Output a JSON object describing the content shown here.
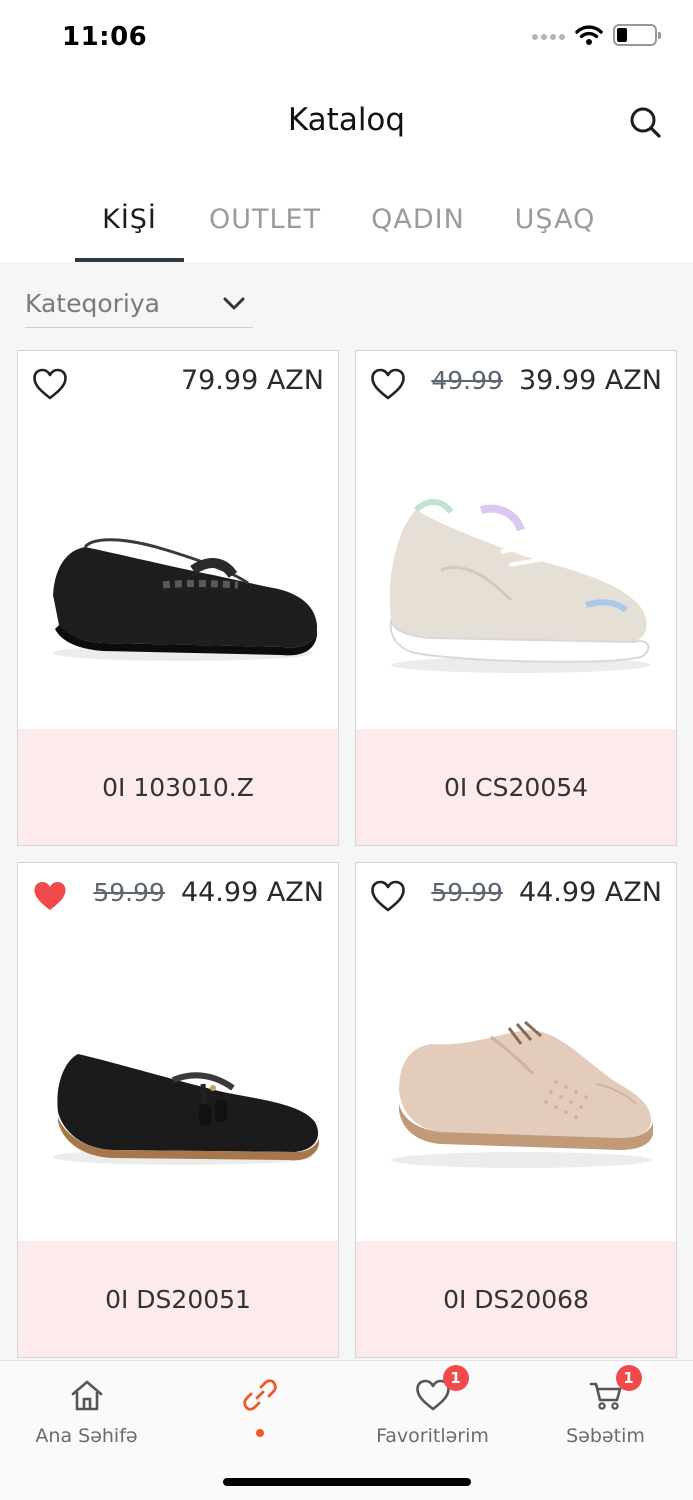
{
  "status_bar": {
    "time": "11:06"
  },
  "header": {
    "title": "Kataloq"
  },
  "tabs": [
    {
      "label": "KİŞİ",
      "active": true
    },
    {
      "label": "OUTLET",
      "active": false
    },
    {
      "label": "QADIN",
      "active": false
    },
    {
      "label": "UŞAQ",
      "active": false
    }
  ],
  "filter": {
    "category_label": "Kateqoriya"
  },
  "products": [
    {
      "price": "79.99 AZN",
      "old_price": "",
      "code": "0I 103010.Z",
      "favorited": false,
      "shoe": "black loafer wedge"
    },
    {
      "price": "39.99 AZN",
      "old_price": "49.99",
      "code": "0I CS20054",
      "favorited": false,
      "shoe": "beige sneaker"
    },
    {
      "price": "44.99 AZN",
      "old_price": "59.99",
      "code": "0I DS20051",
      "favorited": true,
      "shoe": "black tassel loafer"
    },
    {
      "price": "44.99 AZN",
      "old_price": "59.99",
      "code": "0I DS20068",
      "favorited": false,
      "shoe": "beige lace-up oxford"
    }
  ],
  "bottom_nav": {
    "home_label": "Ana Səhifə",
    "favorites_label": "Favoritlərim",
    "favorites_badge": "1",
    "cart_label": "Səbətim",
    "cart_badge": "1"
  },
  "colors": {
    "accent": "#f0582a",
    "heart_active": "#f04a4a",
    "card_footer": "#fdeaea",
    "tab_indicator": "#2e3a46"
  }
}
